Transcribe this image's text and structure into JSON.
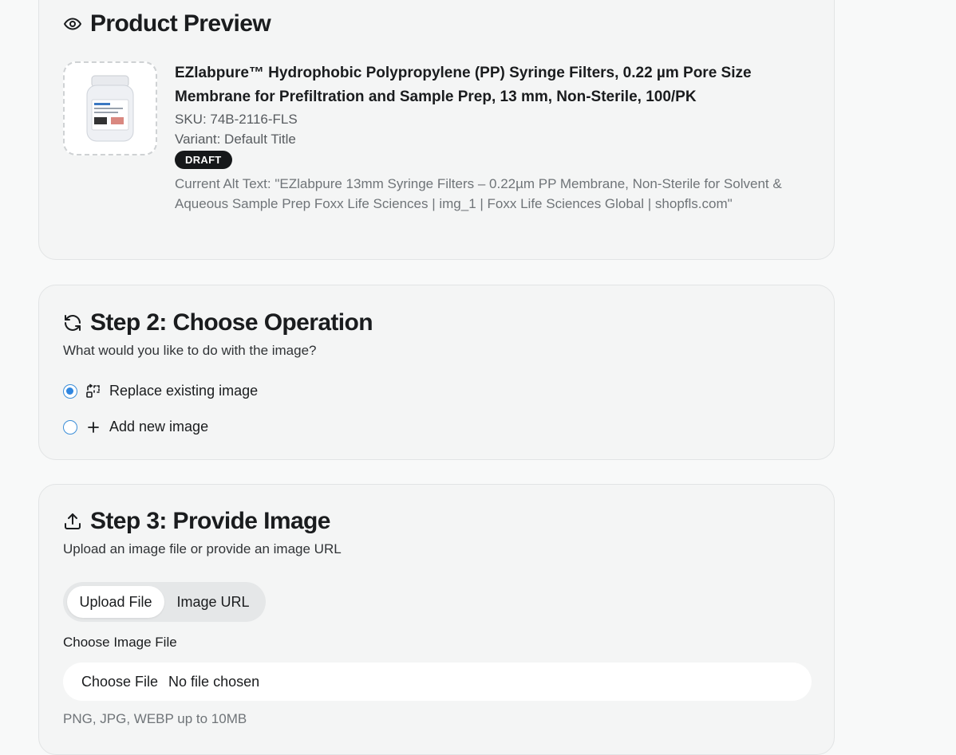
{
  "preview": {
    "heading": "Product Preview",
    "title": "EZlabpure™ Hydrophobic Polypropylene (PP) Syringe Filters, 0.22 µm Pore Size Membrane for Prefiltration and Sample Prep, 13 mm, Non-Sterile, 100/PK",
    "sku": "SKU: 74B-2116-FLS",
    "variant": "Variant: Default Title",
    "status": "DRAFT",
    "alt_text": "Current Alt Text: \"EZlabpure 13mm Syringe Filters – 0.22µm PP Membrane, Non-Sterile for Solvent & Aqueous Sample Prep Foxx Life Sciences | img_1 | Foxx Life Sciences Global | shopfls.com\"",
    "icon": "eye-icon"
  },
  "step2": {
    "heading": "Step 2: Choose Operation",
    "subtitle": "What would you like to do with the image?",
    "options": [
      {
        "label": "Replace existing image",
        "selected": true,
        "icon": "replace-icon"
      },
      {
        "label": "Add new image",
        "selected": false,
        "icon": "plus-icon"
      }
    ],
    "icon": "refresh-icon"
  },
  "step3": {
    "heading": "Step 3: Provide Image",
    "subtitle": "Upload an image file or provide an image URL",
    "tabs": [
      "Upload File",
      "Image URL"
    ],
    "active_tab": "Upload File",
    "file_label": "Choose Image File",
    "file_button": "Choose File",
    "file_status": "No file chosen",
    "hint": "PNG, JPG, WEBP up to 10MB",
    "icon": "upload-icon"
  },
  "colors": {
    "accent": "#2f86e0",
    "badge_bg": "#16181a"
  }
}
